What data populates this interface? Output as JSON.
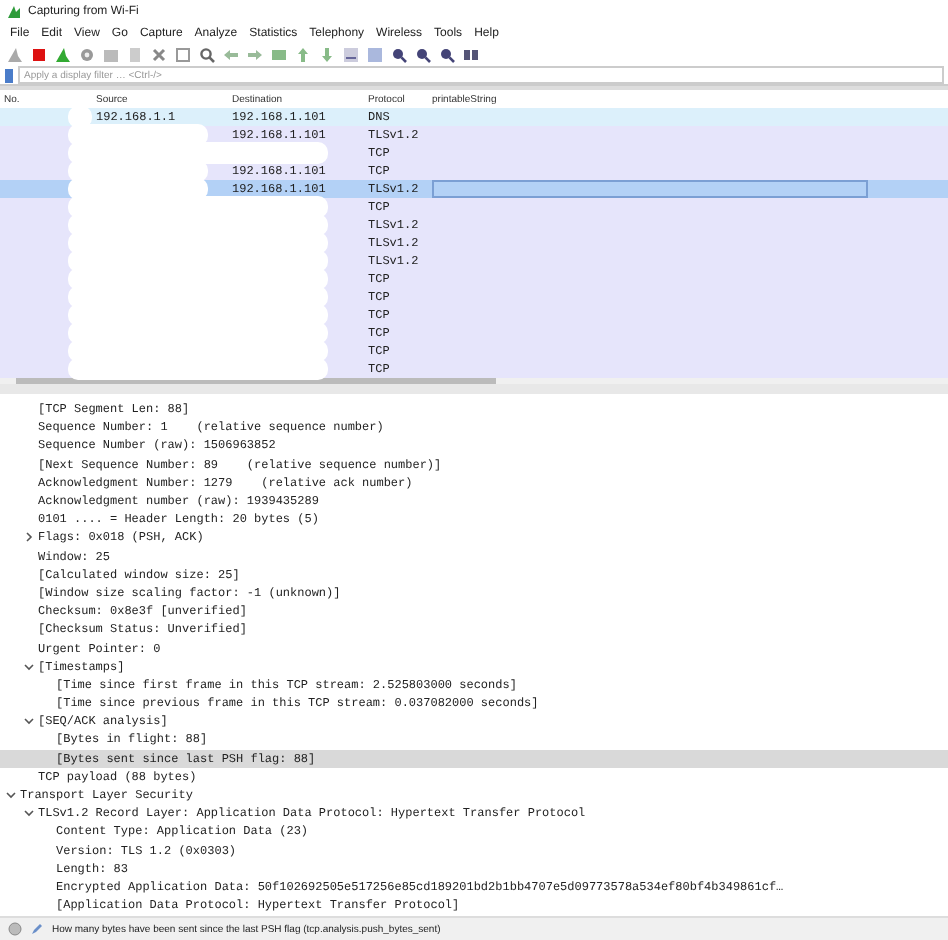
{
  "window": {
    "title": "Capturing from Wi-Fi"
  },
  "menu": [
    "File",
    "Edit",
    "View",
    "Go",
    "Capture",
    "Analyze",
    "Statistics",
    "Telephony",
    "Wireless",
    "Tools",
    "Help"
  ],
  "filter": {
    "placeholder": "Apply a display filter … <Ctrl-/>"
  },
  "packet_list": {
    "columns": [
      "No.",
      "Source",
      "Destination",
      "Protocol",
      "printableString"
    ],
    "rows": [
      {
        "source": "192.168.1.1",
        "destination": "192.168.1.101",
        "protocol": "DNS",
        "color": "#dcf0fb",
        "selected": false,
        "redacted": true
      },
      {
        "destination": "192.168.1.101",
        "protocol": "TLSv1.2",
        "color": "#e6e5fb",
        "selected": false,
        "redacted": true
      },
      {
        "protocol": "TCP",
        "color": "#e6e5fb",
        "selected": false,
        "redacted": true
      },
      {
        "destination": "192.168.1.101",
        "protocol": "TCP",
        "color": "#e6e5fb",
        "selected": false,
        "redacted": true
      },
      {
        "destination": "192.168.1.101",
        "protocol": "TLSv1.2",
        "color": "#b3d1f6",
        "selected": true,
        "redacted": true
      },
      {
        "protocol": "TCP",
        "color": "#e6e5fb",
        "selected": false,
        "redacted": true
      },
      {
        "protocol": "TLSv1.2",
        "color": "#e6e5fb",
        "selected": false,
        "redacted": true
      },
      {
        "protocol": "TLSv1.2",
        "color": "#e6e5fb",
        "selected": false,
        "redacted": true
      },
      {
        "protocol": "TLSv1.2",
        "color": "#e6e5fb",
        "selected": false,
        "redacted": true
      },
      {
        "protocol": "TCP",
        "color": "#e6e5fb",
        "selected": false,
        "redacted": true
      },
      {
        "protocol": "TCP",
        "color": "#e6e5fb",
        "selected": false,
        "redacted": true
      },
      {
        "protocol": "TCP",
        "color": "#e6e5fb",
        "selected": false,
        "redacted": true
      },
      {
        "protocol": "TCP",
        "color": "#e6e5fb",
        "selected": false,
        "redacted": true
      },
      {
        "protocol": "TCP",
        "color": "#e6e5fb",
        "selected": false,
        "redacted": true
      },
      {
        "protocol": "TCP",
        "color": "#e6e5fb",
        "selected": false,
        "redacted": true
      }
    ]
  },
  "details": {
    "tcp_fields": [
      {
        "label": "[TCP Segment Len: 88]",
        "selected": false
      },
      {
        "label": "Sequence Number: 1    (relative sequence number)",
        "selected": false
      },
      {
        "label": "Sequence Number (raw): 1506963852",
        "selected": false
      },
      {
        "label": "[Next Sequence Number: 89    (relative sequence number)]",
        "selected": false
      },
      {
        "label": "Acknowledgment Number: 1279    (relative ack number)",
        "selected": false
      },
      {
        "label": "Acknowledgment number (raw): 1939435289",
        "selected": false
      },
      {
        "label": "0101 .... = Header Length: 20 bytes (5)",
        "selected": false
      },
      {
        "label": "Flags: 0x018 (PSH, ACK)",
        "selected": false,
        "expanded": false
      },
      {
        "label": "Window: 25",
        "selected": false
      },
      {
        "label": "[Calculated window size: 25]",
        "selected": false
      },
      {
        "label": "[Window size scaling factor: -1 (unknown)]",
        "selected": false
      },
      {
        "label": "Checksum: 0x8e3f [unverified]",
        "selected": false
      },
      {
        "label": "[Checksum Status: Unverified]",
        "selected": false
      },
      {
        "label": "Urgent Pointer: 0",
        "selected": false
      },
      {
        "label": "[Timestamps]",
        "selected": false,
        "expanded": true,
        "children": [
          {
            "label": "[Time since first frame in this TCP stream: 2.525803000 seconds]",
            "selected": false
          },
          {
            "label": "[Time since previous frame in this TCP stream: 0.037082000 seconds]",
            "selected": false
          }
        ]
      },
      {
        "label": "[SEQ/ACK analysis]",
        "selected": false,
        "expanded": true,
        "children": [
          {
            "label": "[Bytes in flight: 88]",
            "selected": false
          },
          {
            "label": "[Bytes sent since last PSH flag: 88]",
            "selected": true
          }
        ]
      },
      {
        "label": "TCP payload (88 bytes)",
        "selected": false
      }
    ],
    "tls_layer": {
      "label": "Transport Layer Security",
      "selected": false,
      "expanded": true,
      "children": [
        {
          "label": "TLSv1.2 Record Layer: Application Data Protocol: Hypertext Transfer Protocol",
          "selected": false,
          "expanded": true,
          "children": [
            {
              "label": "Content Type: Application Data (23)",
              "selected": false
            },
            {
              "label": "Version: TLS 1.2 (0x0303)",
              "selected": false
            },
            {
              "label": "Length: 83",
              "selected": false
            },
            {
              "label": "Encrypted Application Data: 50f102692505e517256e85cd189201bd2b1bb4707e5d09773578a534ef80bf4b349861cf…",
              "selected": false
            },
            {
              "label": "[Application Data Protocol: Hypertext Transfer Protocol]",
              "selected": false
            }
          ]
        }
      ]
    }
  },
  "status_bar": {
    "text": "How many bytes have been sent since the last PSH flag (tcp.analysis.push_bytes_sent)"
  }
}
